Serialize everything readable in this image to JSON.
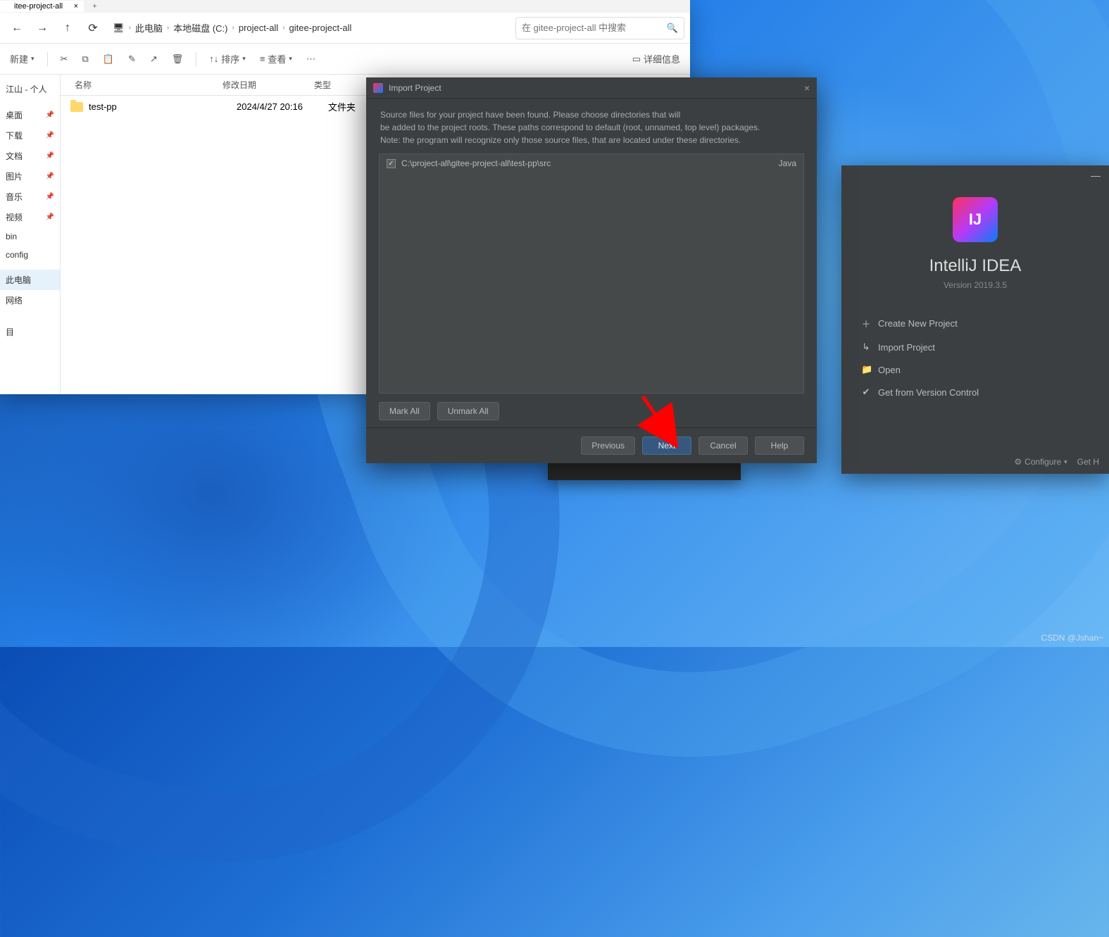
{
  "explorer": {
    "tab_title": "itee-project-all",
    "breadcrumb": [
      "此电脑",
      "本地磁盘 (C:)",
      "project-all",
      "gitee-project-all"
    ],
    "search_placeholder": "在 gitee-project-all 中搜索",
    "new_label": "新建",
    "sort_label": "排序",
    "view_label": "查看",
    "details_label": "详细信息",
    "columns": {
      "name": "名称",
      "date": "修改日期",
      "type": "类型"
    },
    "files": [
      {
        "name": "test-pp",
        "date": "2024/4/27 20:16",
        "type": "文件夹"
      }
    ],
    "sidebar_top": "江山 - 个人",
    "sidebar_items": [
      "桌面",
      "下载",
      "文档",
      "图片",
      "音乐",
      "视频",
      "bin",
      "config"
    ],
    "sidebar_thispc": "此电脑",
    "sidebar_network": "网络",
    "sidebar_bottom": "目"
  },
  "idea_welcome": {
    "logo_text": "IJ",
    "title": "IntelliJ IDEA",
    "version": "Version 2019.3.5",
    "actions": [
      {
        "icon": "＋",
        "label": "Create New Project"
      },
      {
        "icon": "↳",
        "label": "Import Project"
      },
      {
        "icon": "📁",
        "label": "Open"
      },
      {
        "icon": "✔",
        "label": "Get from Version Control"
      }
    ],
    "configure": "Configure",
    "gethelp": "Get H"
  },
  "import_dialog": {
    "title": "Import Project",
    "desc1": "Source files for your project have been found. Please choose directories that will",
    "desc2": "be added to the project roots. These paths correspond to default (root, unnamed, top level) packages.",
    "desc3": "Note: the program will recognize only those source files, that are located under these directories.",
    "rows": [
      {
        "checked": true,
        "path": "C:\\project-all\\gitee-project-all\\test-pp\\src",
        "lang": "Java"
      }
    ],
    "mark_all": "Mark All",
    "unmark_all": "Unmark All",
    "previous": "Previous",
    "next": "Next",
    "cancel": "Cancel",
    "help": "Help"
  },
  "watermark": "CSDN @Jshan~"
}
